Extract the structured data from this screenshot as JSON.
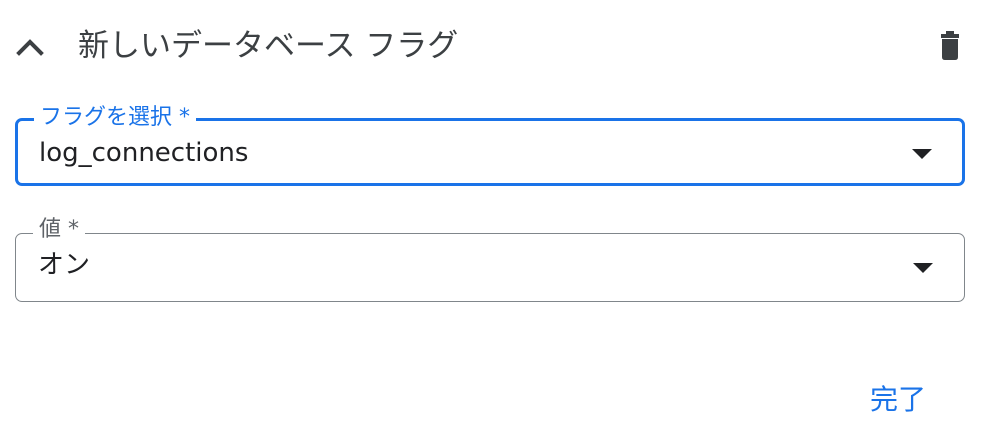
{
  "header": {
    "title": "新しいデータベース フラグ",
    "collapse_icon": "chevron-up-icon",
    "delete_icon": "trash-icon"
  },
  "flag_field": {
    "label": "フラグを選択 *",
    "value": "log_connections",
    "icon": "dropdown-arrow-icon"
  },
  "value_field": {
    "label": "値 *",
    "value": "オン",
    "icon": "dropdown-arrow-icon"
  },
  "actions": {
    "done_label": "完了"
  },
  "colors": {
    "accent": "#1a73e8",
    "border": "#80868b",
    "text": "#202124"
  }
}
